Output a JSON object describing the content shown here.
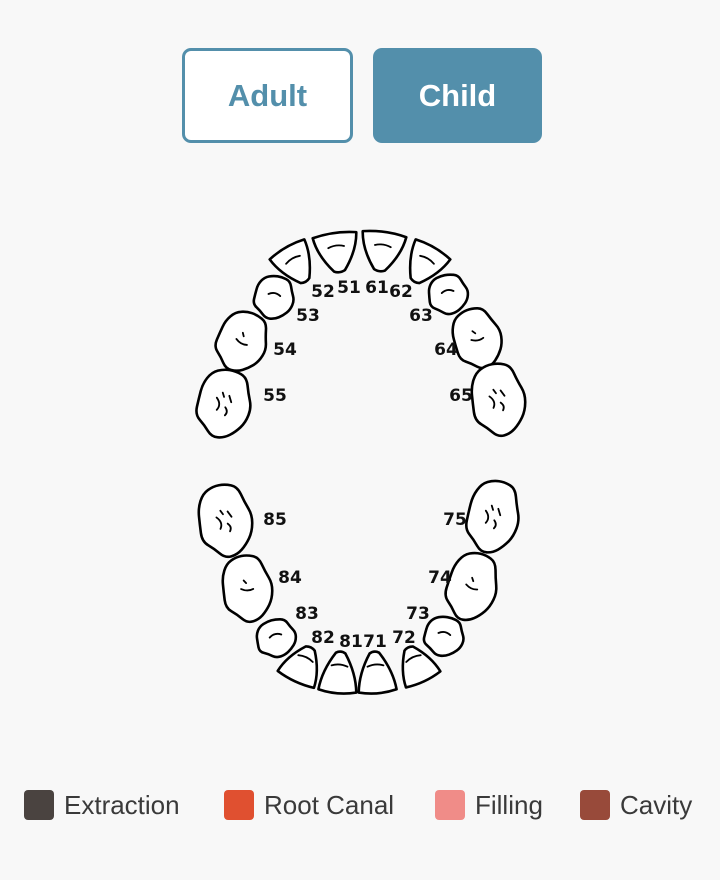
{
  "mode_toggle": {
    "adult_label": "Adult",
    "child_label": "Child",
    "selected": "Child"
  },
  "teeth": {
    "upper_right": [
      "55",
      "54",
      "53",
      "52",
      "51"
    ],
    "upper_left": [
      "61",
      "62",
      "63",
      "64",
      "65"
    ],
    "lower_right": [
      "85",
      "84",
      "83",
      "82",
      "81"
    ],
    "lower_left": [
      "71",
      "72",
      "73",
      "74",
      "75"
    ]
  },
  "legend": [
    {
      "label": "Extraction",
      "color": "#4a4340"
    },
    {
      "label": "Root Canal",
      "color": "#e05030"
    },
    {
      "label": "Filling",
      "color": "#f08c88"
    },
    {
      "label": "Cavity",
      "color": "#984a3a"
    }
  ]
}
